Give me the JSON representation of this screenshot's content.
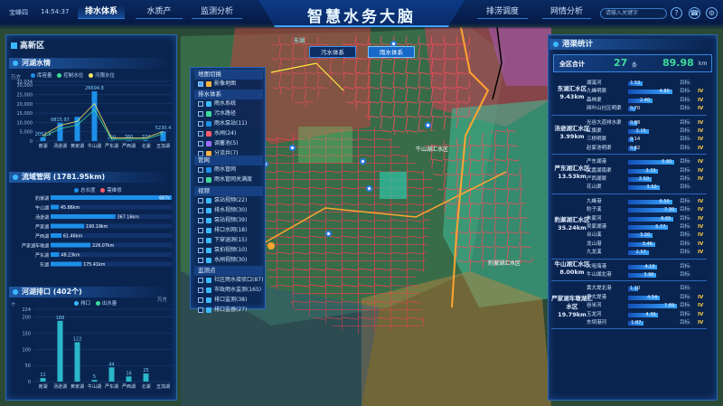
{
  "header": {
    "location": "宝峰四",
    "time": "14:54:37",
    "title": "智慧水务大脑",
    "nav_left": [
      "排水体系",
      "水质产",
      "监测分析"
    ],
    "nav_right": [
      "排涝调度",
      "网情分析"
    ],
    "search_placeholder": "请输入关键字",
    "icons": [
      "search-icon",
      "help-icon",
      "phone-icon",
      "settings-icon"
    ]
  },
  "left_panel": {
    "area": "高新区",
    "river_section": "河湖水情",
    "river_legend": [
      "库容量",
      "控制水位",
      "汛限水位"
    ],
    "river_unit": "万方",
    "river_y_ticks": [
      "32,034",
      "30,000",
      "25,000",
      "20,000",
      "15,000",
      "10,000",
      "5,000",
      "0"
    ],
    "river_categories": [
      "南湖",
      "汤逊湖",
      "黄家湖",
      "牛山湖",
      "严东湖",
      "严西湖",
      "北湖",
      "五加湖"
    ],
    "river_values": [
      2052.3,
      9815.97,
      13000,
      26694.8,
      220,
      380,
      377,
      5230.4
    ],
    "river_labels": [
      "2052.3",
      "9815.97",
      "",
      "26694.8",
      "220",
      "380",
      "377",
      "5230.4"
    ],
    "pipe_section": "流域管网 (1781.95km)",
    "pipe_legend": [
      "总长度",
      "需维修"
    ],
    "pipe_categories": [
      "豹澥湖",
      "牛山湖",
      "汤逊湖",
      "严家湖",
      "严西湖",
      "严家湖车墩湖",
      "严东湖",
      "东湖"
    ],
    "pipe_values": [
      687,
      45.86,
      367.16,
      190.19,
      61.46,
      226.07,
      48.23,
      175.41
    ],
    "pipe_labels": [
      "687k",
      "45.86km",
      "367.16km",
      "190.19km",
      "61.46km",
      "226.07km",
      "48.23km",
      "175.41km"
    ],
    "outlet_section": "河湖排口 (402个)",
    "outlet_legend": [
      "排口",
      "出水量"
    ],
    "outlet_unit_left": "个",
    "outlet_unit_right": "万方",
    "outlet_y_ticks": [
      "224",
      "200",
      "150",
      "100",
      "50",
      "0"
    ],
    "outlet_categories": [
      "南湖",
      "汤逊湖",
      "黄家湖",
      "牛山湖",
      "严东湖",
      "严西湖",
      "北湖",
      "五加湖"
    ],
    "outlet_values": [
      11,
      188,
      122,
      5,
      44,
      16,
      25,
      0
    ],
    "outlet_labels": [
      "11",
      "188",
      "122",
      "5",
      "44",
      "16",
      "25",
      ""
    ]
  },
  "layers": {
    "title": "地图切换",
    "basemap": "影像地图",
    "group_drain": "排水体系",
    "drain_items": [
      "雨水系统",
      "污水路径",
      "雨水泵站(11)",
      "水闸(24)",
      "调蓄池(5)",
      "分流井(7)"
    ],
    "group_pipe": "管网",
    "pipe_items": [
      "雨水管网",
      "雨水管网关满度"
    ],
    "group_video": "视频",
    "video_items": [
      "泵站视频(22)",
      "排水视频(30)",
      "泵站视频(39)",
      "排口水网(18)",
      "下穿涵洞(15)",
      "泵拍视频(10)",
      "水闸视频(30)"
    ],
    "group_monitor": "监测点",
    "monitor_items": [
      "社区雨水接驳口(87)",
      "市政雨水监测(165)",
      "排口监测(38)",
      "排口监器(27)"
    ]
  },
  "map": {
    "tab_sewage": "污水体系",
    "tab_rain": "雨水体系",
    "labels": [
      "东湖",
      "豹澥湖汇水区",
      "牛山湖汇水区"
    ]
  },
  "right_panel": {
    "title": "港渠统计",
    "total_label": "全区合计",
    "total_count": "27",
    "count_unit": "条",
    "total_length": "89.98",
    "length_unit": "km",
    "target_label": "目标:",
    "districts": [
      {
        "name": "东湖汇水区",
        "length": "9.43km",
        "rows": [
          {
            "name": "湖溪河",
            "value": "1.53",
            "ratio": 0.3,
            "level": ""
          },
          {
            "name": "九峰明渠",
            "value": "4.80",
            "ratio": 0.9,
            "level": "IV"
          },
          {
            "name": "森林渠",
            "value": "2.40",
            "ratio": 0.5,
            "level": "IV"
          },
          {
            "name": "网叶山社区明渠",
            "value": "0.70",
            "ratio": 0.15,
            "level": "IV"
          }
        ]
      },
      {
        "name": "汤逊湖汇水区",
        "length": "3.99km",
        "rows": [
          {
            "name": "光谷大道排水渠",
            "value": "0.88",
            "ratio": 0.18,
            "level": "IV"
          },
          {
            "name": "红旗渠",
            "value": "2.15",
            "ratio": 0.42,
            "level": "IV"
          },
          {
            "name": "三桥明渠",
            "value": "0.14",
            "ratio": 0.05,
            "level": "IV"
          },
          {
            "name": "赵家池明渠",
            "value": "0.82",
            "ratio": 0.17,
            "level": "IV"
          }
        ]
      },
      {
        "name": "严东湖汇水区",
        "length": "13.53km",
        "rows": [
          {
            "name": "严东湖港",
            "value": "5.80",
            "ratio": 0.95,
            "level": "IV"
          },
          {
            "name": "武嘉湖南渠",
            "value": "3.33",
            "ratio": 0.62,
            "level": "IV"
          },
          {
            "name": "严西湖渠",
            "value": "2.50",
            "ratio": 0.48,
            "level": "IV"
          },
          {
            "name": "花山渠",
            "value": "3.50",
            "ratio": 0.64,
            "level": ""
          }
        ]
      },
      {
        "name": "豹澥湖汇水区",
        "length": "35.24km",
        "rows": [
          {
            "name": "九峰港",
            "value": "6.50",
            "ratio": 0.9,
            "level": "IV"
          },
          {
            "name": "豹子溪",
            "value": "7.30",
            "ratio": 1.0,
            "level": "IV"
          },
          {
            "name": "朱家河",
            "value": "6.65",
            "ratio": 0.93,
            "level": "IV"
          },
          {
            "name": "吴家湖港",
            "value": "5.77",
            "ratio": 0.82,
            "level": "IV"
          },
          {
            "name": "台山溪",
            "value": "3.20",
            "ratio": 0.5,
            "level": "IV"
          },
          {
            "name": "龙山港",
            "value": "3.46",
            "ratio": 0.55,
            "level": "IV"
          },
          {
            "name": "九龙溪",
            "value": "2.57",
            "ratio": 0.42,
            "level": "IV"
          }
        ]
      },
      {
        "name": "牛山湖汇水区",
        "length": "8.00km",
        "rows": [
          {
            "name": "大咀海港",
            "value": "4.10",
            "ratio": 0.6,
            "level": ""
          },
          {
            "name": "牛山湖北港",
            "value": "3.90",
            "ratio": 0.58,
            "level": ""
          }
        ]
      },
      {
        "name": "严家湖车墩湖汇水区",
        "length": "19.79km",
        "rows": [
          {
            "name": "黄大堤北港",
            "value": "1.10",
            "ratio": 0.2,
            "level": ""
          },
          {
            "name": "黄大堤港",
            "value": "4.54",
            "ratio": 0.65,
            "level": "IV"
          },
          {
            "name": "谷米河",
            "value": "7.89",
            "ratio": 1.0,
            "level": "IV"
          },
          {
            "name": "玉龙河",
            "value": "4.30",
            "ratio": 0.62,
            "level": "IV"
          },
          {
            "name": "东坝港河",
            "value": "1.87",
            "ratio": 0.32,
            "level": "IV"
          }
        ]
      }
    ]
  },
  "colors": {
    "accent": "#3bb9ff",
    "pipe_red": "#ff3b4e",
    "level": "#ffd23f",
    "bar_blue": "#1d8fe8"
  }
}
